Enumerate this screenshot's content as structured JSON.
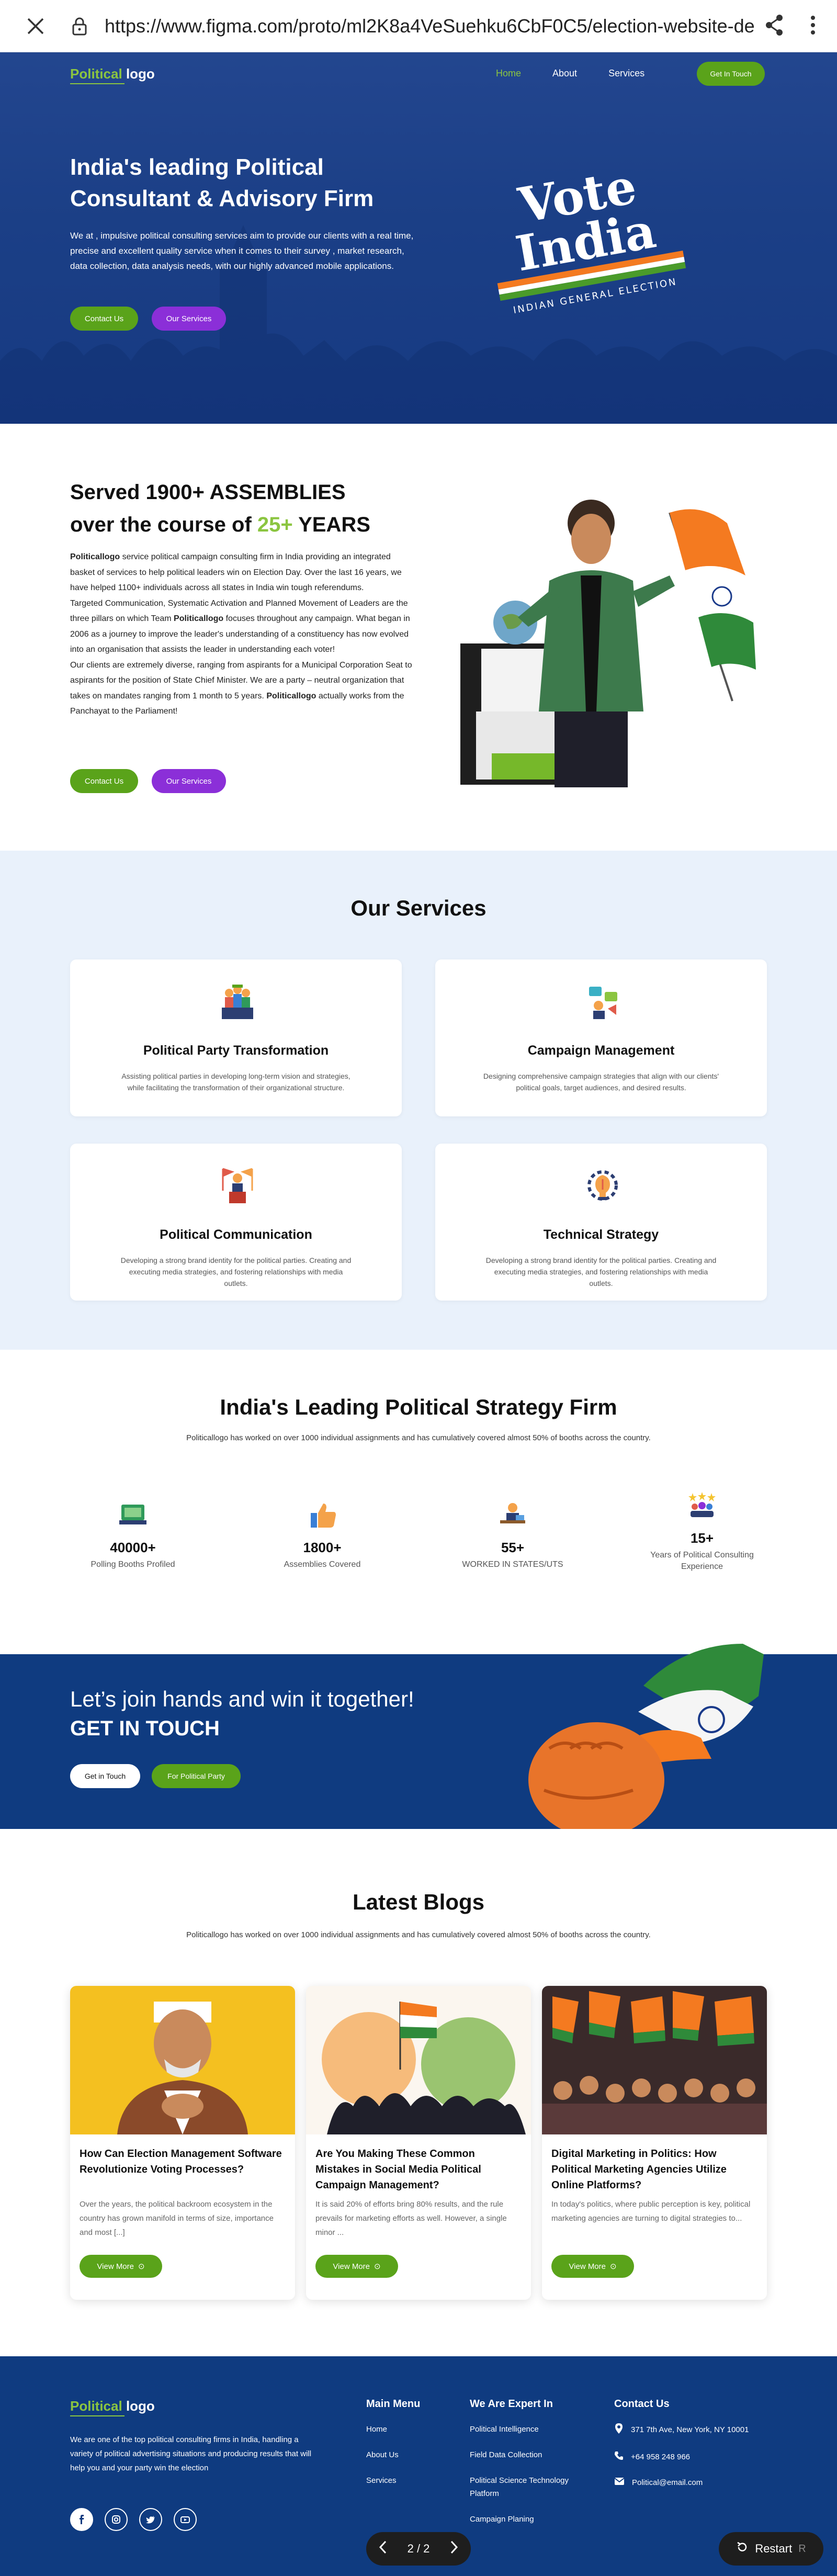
{
  "browser": {
    "url": "https://www.figma.com/proto/ml2K8a4VeSuehku6CbF0C5/election-website-de"
  },
  "nav": {
    "logo_part1": "Political",
    "logo_part2": "logo",
    "items": [
      "Home",
      "About",
      "Services"
    ],
    "cta": "Get In Touch"
  },
  "hero": {
    "title": "India's leading Political Consultant & Advisory Firm",
    "description": "We at , impulsive political consulting services aim to provide our clients with a real time, precise and excellent quality service when it comes to their survey , market research, data collection, data analysis needs, with our highly advanced mobile applications.",
    "btn_contact": "Contact Us",
    "btn_services": "Our Services",
    "vote_line1": "Vote",
    "vote_line2": "India",
    "vote_sub": "INDIAN GENERAL ELECTION"
  },
  "served": {
    "title_a": "Served 1900+ ASSEMBLIES",
    "title_b": "over the course of ",
    "title_num": "25+",
    "title_c": " YEARS",
    "p1_bold": "Politicallogo",
    "p1": " service political campaign consulting firm in India providing an integrated basket of services to help political leaders win on Election Day. Over the last 16 years, we have helped 1100+ individuals across all states in India win tough referendums.",
    "p2a": "Targeted Communication, Systematic Activation and Planned Movement of Leaders are the three pillars on which Team ",
    "p2_bold": "Politicallogo",
    "p2b": " focuses throughout any campaign. What began in 2006 as a journey to improve the leader's understanding of a constituency has now evolved into an organisation that assists the leader in understanding each voter!",
    "p3a": "Our clients are extremely diverse, ranging from aspirants for a Municipal Corporation Seat to aspirants for the position of State Chief Minister. We are a party – neutral organization that takes on mandates ranging from 1 month to 5 years. ",
    "p3_bold": "Politicallogo",
    "p3b": "  actually works from the Panchayat to the Parliament!",
    "btn_contact": "Contact Us",
    "btn_services": "Our Services"
  },
  "services": {
    "title": "Our Services",
    "cards": [
      {
        "title": "Political Party Transformation",
        "desc": "Assisting political parties in developing long-term vision and strategies, while facilitating the transformation of their organizational structure."
      },
      {
        "title": "Campaign Management",
        "desc": "Designing comprehensive campaign strategies that align with our clients' political goals, target audiences, and desired results."
      },
      {
        "title": "Political Communication",
        "desc": "Developing a strong brand identity for the political parties. Creating and executing media strategies, and fostering relationships with media outlets."
      },
      {
        "title": "Technical Strategy",
        "desc": "Developing a strong brand identity for the political parties. Creating and executing media strategies, and fostering relationships with media outlets."
      }
    ]
  },
  "strategy": {
    "title": "India's Leading Political Strategy Firm",
    "subtitle": "Politicallogo has worked on over 1000 individual assignments and has cumulatively covered almost 50% of booths across the country.",
    "stats": [
      {
        "value": "40000+",
        "label": "Polling Booths Profiled"
      },
      {
        "value": "1800+",
        "label": "Assemblies Covered"
      },
      {
        "value": "55+",
        "label": "WORKED IN STATES/UTS"
      },
      {
        "value": "15+",
        "label": "Years of Political Consulting Experience"
      }
    ]
  },
  "cta": {
    "line1": "Let’s join hands and win it together!",
    "line2": "GET IN TOUCH",
    "btn1": "Get in Touch",
    "btn2": "For Political Party"
  },
  "blogs": {
    "title": "Latest Blogs",
    "subtitle": "Politicallogo has worked on over 1000 individual assignments and has cumulatively covered almost 50% of booths across the country.",
    "items": [
      {
        "title": "How Can Election Management Software Revolutionize Voting Processes?",
        "desc": "Over the years, the political backroom ecosystem in the country has grown manifold in terms of size, importance and most [...]",
        "btn": "View More"
      },
      {
        "title": "Are You Making These Common Mistakes in Social Media Political Campaign Management?",
        "desc": "It is said 20% of efforts bring 80% results, and the rule prevails for marketing efforts as well. However, a single minor ...",
        "btn": "View More"
      },
      {
        "title": "Digital Marketing in Politics: How Political Marketing Agencies Utilize Online Platforms?",
        "desc": "In today's politics, where public perception is key, political marketing agencies are turning to digital strategies to...",
        "btn": "View More"
      }
    ]
  },
  "footer": {
    "logo_part1": "Political",
    "logo_part2": "logo",
    "desc": "We are one of the top political consulting firms in India, handling a variety of political advertising situations and producing results that will help you and your party win the election",
    "col1_title": "Main Menu",
    "col1": [
      "Home",
      "About Us",
      "Services"
    ],
    "col2_title": "We Are Expert In",
    "col2": [
      "Political Intelligence",
      "Field Data Collection",
      "Political Science Technology Platform",
      "Campaign Planing"
    ],
    "col3_title": "Contact Us",
    "address": "371 7th Ave, New York, NY 10001",
    "phone": "+64 958 248 966",
    "email": "Political@email.com"
  },
  "overlay": {
    "page": "2 / 2",
    "restart": "Restart",
    "restart_key": "R"
  },
  "colors": {
    "brand_blue": "#0f3b80",
    "accent_green": "#5aa31a",
    "purple": "#8b2fd8"
  }
}
